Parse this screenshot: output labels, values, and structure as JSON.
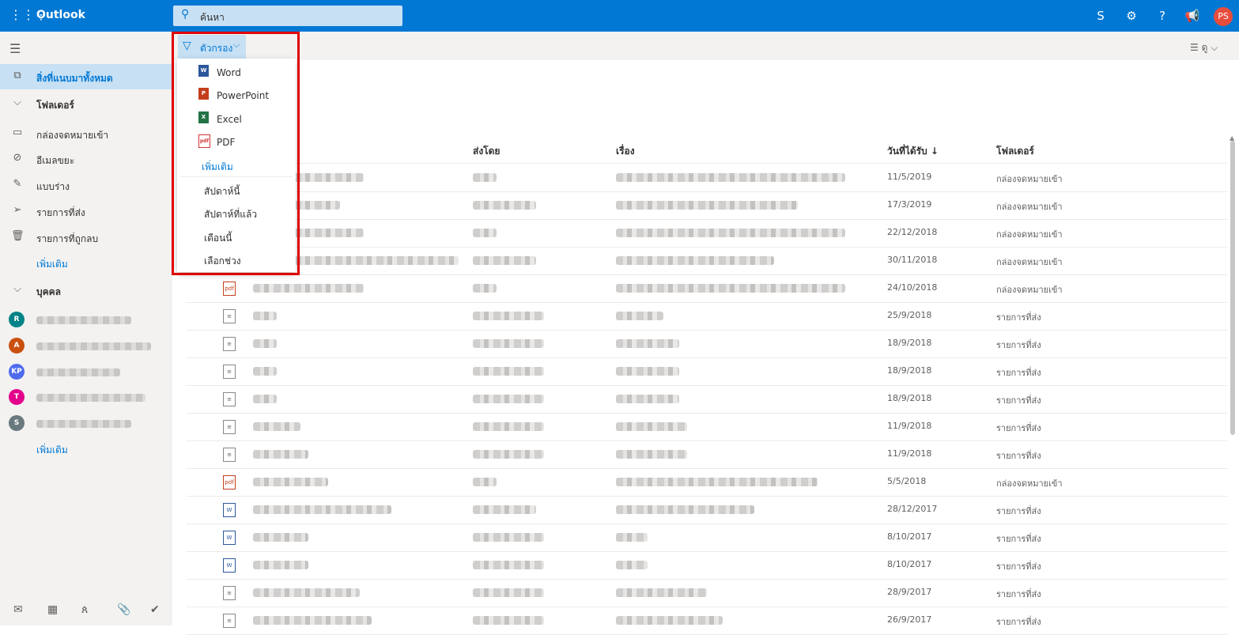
{
  "topbar": {
    "app_name": "Outlook",
    "search_placeholder": "ค้นหา",
    "user_initials": "PS",
    "accent_color": "#0078d4"
  },
  "sidebar": {
    "items": [
      {
        "label": "สิ่งที่แนบมาทั้งหมด",
        "icon": "attachment-icon"
      },
      {
        "label": "โฟลเดอร์",
        "icon": "chevron-down-icon"
      },
      {
        "label": "กล่องจดหมายเข้า",
        "icon": "inbox-icon"
      },
      {
        "label": "อีเมลขยะ",
        "icon": "junk-icon"
      },
      {
        "label": "แบบร่าง",
        "icon": "pencil-icon"
      },
      {
        "label": "รายการที่ส่ง",
        "icon": "send-icon"
      },
      {
        "label": "รายการที่ถูกลบ",
        "icon": "trash-icon"
      }
    ],
    "more_folders": "เพิ่มเติม",
    "people_header": "บุคคล",
    "people": [
      {
        "initial": "R",
        "color": "#038387"
      },
      {
        "initial": "A",
        "color": "#ca5010"
      },
      {
        "initial": "KP",
        "color": "#4f6bed"
      },
      {
        "initial": "T",
        "color": "#e3008c"
      },
      {
        "initial": "S",
        "color": "#69797e"
      }
    ],
    "more_people": "เพิ่มเติม"
  },
  "command_bar": {
    "filter_label": "ตัวกรอง",
    "view_label": "ดู"
  },
  "filter_menu": {
    "types": [
      {
        "label": "Word",
        "icon": "word-icon",
        "badge": "W",
        "color": "#2b579a"
      },
      {
        "label": "PowerPoint",
        "icon": "powerpoint-icon",
        "badge": "P",
        "color": "#c43e1c"
      },
      {
        "label": "Excel",
        "icon": "excel-icon",
        "badge": "X",
        "color": "#217346"
      },
      {
        "label": "PDF",
        "icon": "pdf-icon",
        "badge": "pdf",
        "color": "#d13438"
      }
    ],
    "more_label": "เพิ่มเติม",
    "periods": [
      "สัปดาห์นี้",
      "สัปดาห์ที่แล้ว",
      "เดือนนี้",
      "เลือกช่วง"
    ]
  },
  "table": {
    "headers": {
      "sent_by": "ส่งโดย",
      "subject": "เรื่อง",
      "date_received": "วันที่ได้รับ ↓",
      "folder": "โฟลเดอร์"
    },
    "rows": [
      {
        "type": "pdf",
        "date": "11/5/2019",
        "folder": "กล่องจดหมายเข้า"
      },
      {
        "type": "pdf",
        "date": "17/3/2019",
        "folder": "กล่องจดหมายเข้า"
      },
      {
        "type": "pdf",
        "date": "22/12/2018",
        "folder": "กล่องจดหมายเข้า"
      },
      {
        "type": "pdf",
        "date": "30/11/2018",
        "folder": "กล่องจดหมายเข้า"
      },
      {
        "type": "pdf",
        "date": "24/10/2018",
        "folder": "กล่องจดหมายเข้า"
      },
      {
        "type": "file",
        "date": "25/9/2018",
        "folder": "รายการที่ส่ง"
      },
      {
        "type": "file",
        "date": "18/9/2018",
        "folder": "รายการที่ส่ง"
      },
      {
        "type": "file",
        "date": "18/9/2018",
        "folder": "รายการที่ส่ง"
      },
      {
        "type": "file",
        "date": "18/9/2018",
        "folder": "รายการที่ส่ง"
      },
      {
        "type": "file",
        "date": "11/9/2018",
        "folder": "รายการที่ส่ง"
      },
      {
        "type": "file",
        "date": "11/9/2018",
        "folder": "รายการที่ส่ง"
      },
      {
        "type": "pdf",
        "date": "5/5/2018",
        "folder": "กล่องจดหมายเข้า"
      },
      {
        "type": "word",
        "date": "28/12/2017",
        "folder": "รายการที่ส่ง"
      },
      {
        "type": "word",
        "date": "8/10/2017",
        "folder": "รายการที่ส่ง"
      },
      {
        "type": "word",
        "date": "8/10/2017",
        "folder": "รายการที่ส่ง"
      },
      {
        "type": "file",
        "date": "28/9/2017",
        "folder": "รายการที่ส่ง"
      },
      {
        "type": "file",
        "date": "26/9/2017",
        "folder": "รายการที่ส่ง"
      }
    ]
  }
}
